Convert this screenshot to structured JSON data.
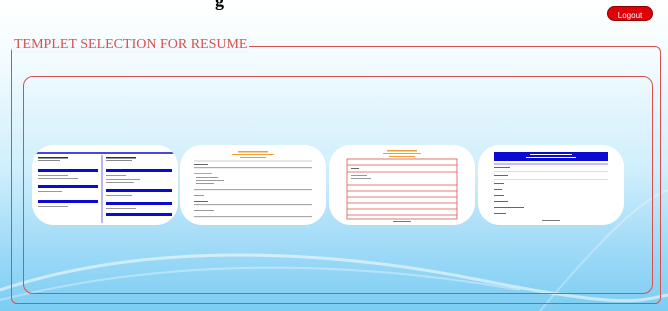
{
  "header": {
    "heading_fragment": "g",
    "logout_label": "Logout"
  },
  "section": {
    "legend": "TEMPLET SELECTION FOR RESUME"
  },
  "templates": [
    {
      "id": 1,
      "accent_color": "#0b0bd0",
      "style": "two-column blue headings"
    },
    {
      "id": 2,
      "accent_color": "#f0a030",
      "style": "single-column with orange header"
    },
    {
      "id": 3,
      "accent_color": "#e05050",
      "style": "red ruled table"
    },
    {
      "id": 4,
      "accent_color": "#0b0bd0",
      "style": "blue banner header"
    }
  ],
  "colors": {
    "frame_red": "#d6504e",
    "logout_red": "#e0000a"
  }
}
